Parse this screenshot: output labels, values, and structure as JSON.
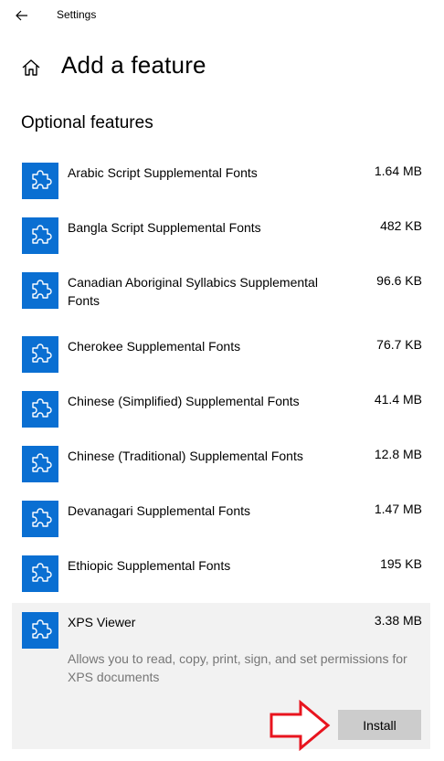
{
  "window": {
    "title": "Settings"
  },
  "header": {
    "title": "Add a feature"
  },
  "section": {
    "title": "Optional features"
  },
  "features": [
    {
      "name": "Arabic Script Supplemental Fonts",
      "size": "1.64 MB"
    },
    {
      "name": "Bangla Script Supplemental Fonts",
      "size": "482 KB"
    },
    {
      "name": "Canadian Aboriginal Syllabics Supplemental Fonts",
      "size": "96.6 KB"
    },
    {
      "name": "Cherokee Supplemental Fonts",
      "size": "76.7 KB"
    },
    {
      "name": "Chinese (Simplified) Supplemental Fonts",
      "size": "41.4 MB"
    },
    {
      "name": "Chinese (Traditional) Supplemental Fonts",
      "size": "12.8 MB"
    },
    {
      "name": "Devanagari Supplemental Fonts",
      "size": "1.47 MB"
    },
    {
      "name": "Ethiopic Supplemental Fonts",
      "size": "195 KB"
    }
  ],
  "selected_feature": {
    "name": "XPS Viewer",
    "size": "3.38 MB",
    "description": "Allows you to read, copy, print, sign, and set permissions for XPS documents",
    "install_label": "Install"
  },
  "icons": {
    "back": "back-arrow-icon",
    "home": "home-icon",
    "feature": "puzzle-piece-icon",
    "annotation": "red-arrow-icon"
  },
  "colors": {
    "accent": "#0a6fd2",
    "selected_bg": "#f2f2f2",
    "button_bg": "#cccccc",
    "description_text": "#767676",
    "annotation_arrow": "#e8141e"
  }
}
